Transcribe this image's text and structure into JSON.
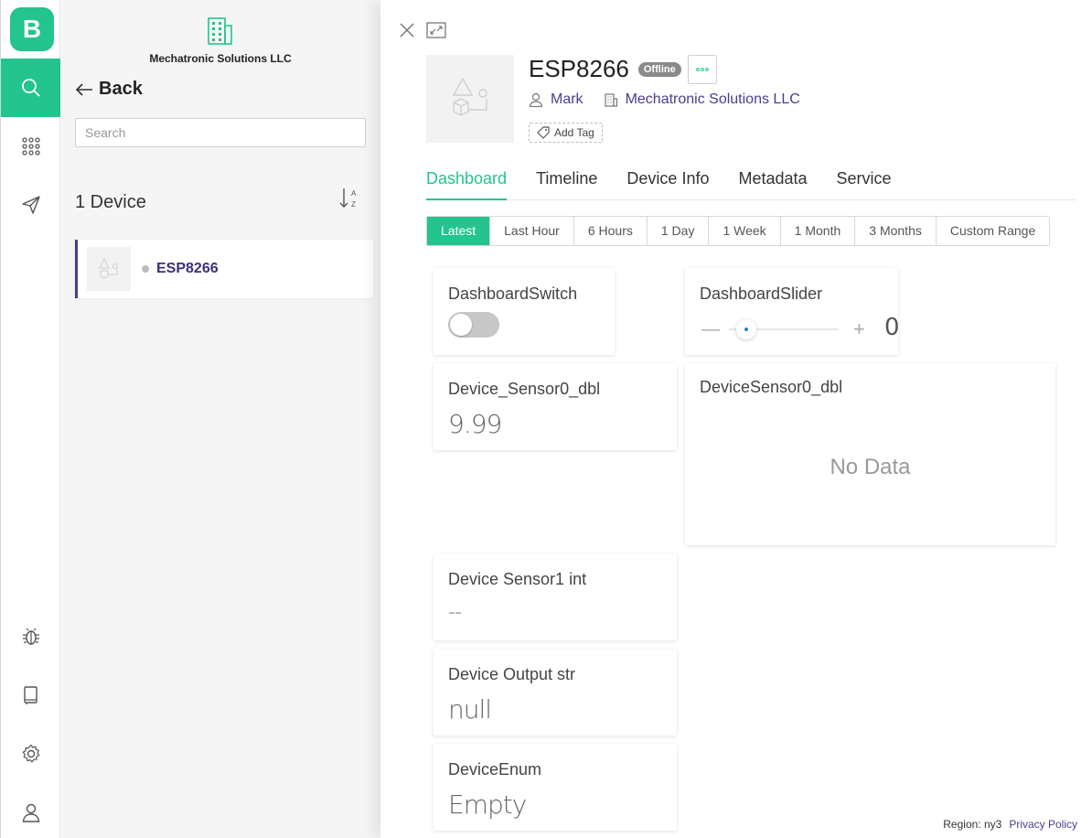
{
  "rail": {
    "logo_letter": "B",
    "nav": [
      "search-icon",
      "grid-icon",
      "send-icon",
      "bug-icon",
      "book-icon",
      "gear-icon",
      "user-icon"
    ],
    "accent": "#23c48e"
  },
  "list": {
    "org_name": "Mechatronic Solutions LLC",
    "back_label": "Back",
    "search_placeholder": "Search",
    "count_label": "1 Device",
    "sort_label_top": "A",
    "sort_label_bottom": "Z",
    "devices": [
      {
        "name": "ESP8266",
        "status_color": "#bdbdbd"
      }
    ]
  },
  "detail": {
    "device_name": "ESP8266",
    "status_badge": "Offline",
    "owner": "Mark",
    "organization": "Mechatronic Solutions LLC",
    "add_tag_label": "Add Tag",
    "tabs": [
      {
        "label": "Dashboard",
        "active": true
      },
      {
        "label": "Timeline",
        "active": false
      },
      {
        "label": "Device Info",
        "active": false
      },
      {
        "label": "Metadata",
        "active": false
      },
      {
        "label": "Service",
        "active": false
      }
    ],
    "ranges": [
      {
        "label": "Latest",
        "active": true
      },
      {
        "label": "Last Hour",
        "active": false
      },
      {
        "label": "6 Hours",
        "active": false
      },
      {
        "label": "1 Day",
        "active": false
      },
      {
        "label": "1 Week",
        "active": false
      },
      {
        "label": "1 Month",
        "active": false
      },
      {
        "label": "3 Months",
        "active": false
      },
      {
        "label": "Custom Range",
        "active": false
      }
    ],
    "widgets": {
      "switch": {
        "title": "DashboardSwitch",
        "on": false
      },
      "slider": {
        "title": "DashboardSlider",
        "minus": "—",
        "plus": "+",
        "value": "0",
        "level": 0
      },
      "sensor0_value": {
        "title": "Device_Sensor0_dbl",
        "value": "9.99"
      },
      "sensor0_chart": {
        "title": "DeviceSensor0_dbl",
        "empty_text": "No Data"
      },
      "sensor1": {
        "title": "Device Sensor1 int",
        "value": "--"
      },
      "output": {
        "title": "Device Output str",
        "value": "null"
      },
      "enum": {
        "title": "DeviceEnum",
        "value": "Empty"
      }
    }
  },
  "footer": {
    "region": "Region: ny3",
    "privacy": "Privacy Policy"
  }
}
